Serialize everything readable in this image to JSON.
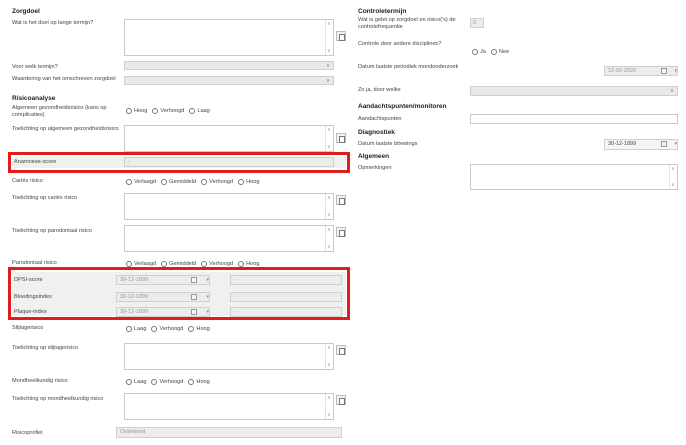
{
  "left": {
    "zorgdoel_heading": "Zorgdoel",
    "long_term_goal_label": "Wat is het doel op lange termijn?",
    "term_label": "Voor welk termijn?",
    "evaluation_label": "Waardering van het omschreven zorgdoel",
    "risico_heading": "Risicoanalyse",
    "general_risk_label": "Algemeen gezondheidsrisico (kans op complicaties)",
    "general_risk_options": [
      "Hoog",
      "Verhoogd",
      "Laag"
    ],
    "general_explanation_label": "Toelichting op algemeen gezondheidsrisico",
    "anamnese_label": "Anamnese-score",
    "anamnese_value": "-",
    "caries_label": "Cariës risico",
    "caries_options": [
      "Verlaagd",
      "Gemiddeld",
      "Verhoogd",
      "Hoog"
    ],
    "caries_explanation_label": "Toelichting op cariës risico",
    "perio_explanation_label": "Toelichting op parodontaal risico",
    "perio_label": "Parodontaal risico",
    "perio_options": [
      "Verlaagd",
      "Gemiddeld",
      "Verhoogd",
      "Hoog"
    ],
    "dpsi_label": "DPSI-score",
    "dpsi_date": "30-12-1899",
    "dpsi_value": "-",
    "bloeding_label": "Bloedingsindex",
    "bloeding_date": "30-12-1899",
    "bloeding_value": "-",
    "plaque_label": "Plaque-index",
    "plaque_date": "30-12-1899",
    "plaque_value": "-",
    "slijtage_label": "Slijtagerisico",
    "slijtage_options": [
      "Laag",
      "Verhoogd",
      "Hoog"
    ],
    "slijtage_explanation_label": "Toelichting op slijtagerisico",
    "mondheelkundig_label": "Mondheelkundig risico",
    "mondheelkundig_options": [
      "Laag",
      "Verhoogd",
      "Hoog"
    ],
    "mondheelkundig_explanation_label": "Toelichting op mondheelkundig risico",
    "risicoprofiel_label": "Risicoprofiel",
    "risicoprofiel_value": "Onbekend"
  },
  "right": {
    "controle_heading": "Controletermijn",
    "frequency_label": "Wat is gelet op zorgdoel en risico('s) de controlefrequentie",
    "frequency_value": "0",
    "other_disciplines_label": "Controle door andere disciplines?",
    "other_disciplines_options": [
      "Ja",
      "Nee"
    ],
    "last_exam_label": "Datum laatste periodiek mondonderzoek",
    "last_exam_date": "12-02-2020",
    "if_yes_label": "Zo ja, door welke",
    "aandacht_heading": "Aandachtspunten/monitoren",
    "aandacht_label": "Aandachtspunten",
    "diagnostiek_heading": "Diagnostiek",
    "last_bitewing_label": "Datum laatste bitewings",
    "last_bitewing_date": "30-12-1899",
    "algemeen_heading": "Algemeen",
    "remarks_label": "Opmerkingen"
  },
  "colors": {
    "highlight": "#e21b1b"
  }
}
